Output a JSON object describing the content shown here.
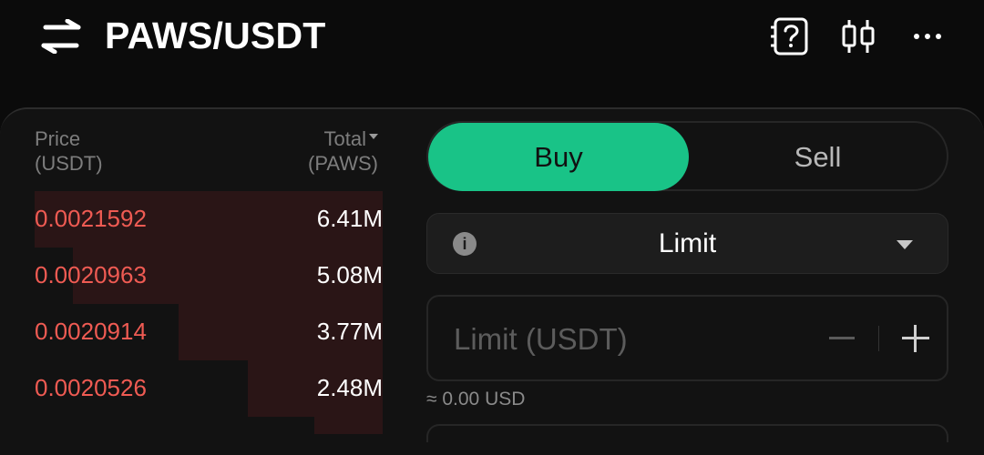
{
  "header": {
    "pair": "PAWS/USDT",
    "icons": [
      "swap-icon",
      "help-document-icon",
      "candlestick-chart-icon",
      "more-options-icon"
    ]
  },
  "orderbook": {
    "price_header": [
      "Price",
      "(USDT)"
    ],
    "total_header": [
      "Total",
      "(PAWS)"
    ],
    "rows": [
      {
        "price": "0.0021592",
        "total": "6.41M"
      },
      {
        "price": "0.0020963",
        "total": "5.08M"
      },
      {
        "price": "0.0020914",
        "total": "3.77M"
      },
      {
        "price": "0.0020526",
        "total": "2.48M"
      }
    ]
  },
  "trade": {
    "buy_label": "Buy",
    "sell_label": "Sell",
    "order_type": "Limit",
    "price_placeholder": "Limit (USDT)",
    "approx_value": "≈ 0.00 USD"
  },
  "colors": {
    "buy": "#19c387",
    "ask_price": "#ef5b53",
    "background": "#0b0b0b",
    "depth": "#2a1516"
  }
}
